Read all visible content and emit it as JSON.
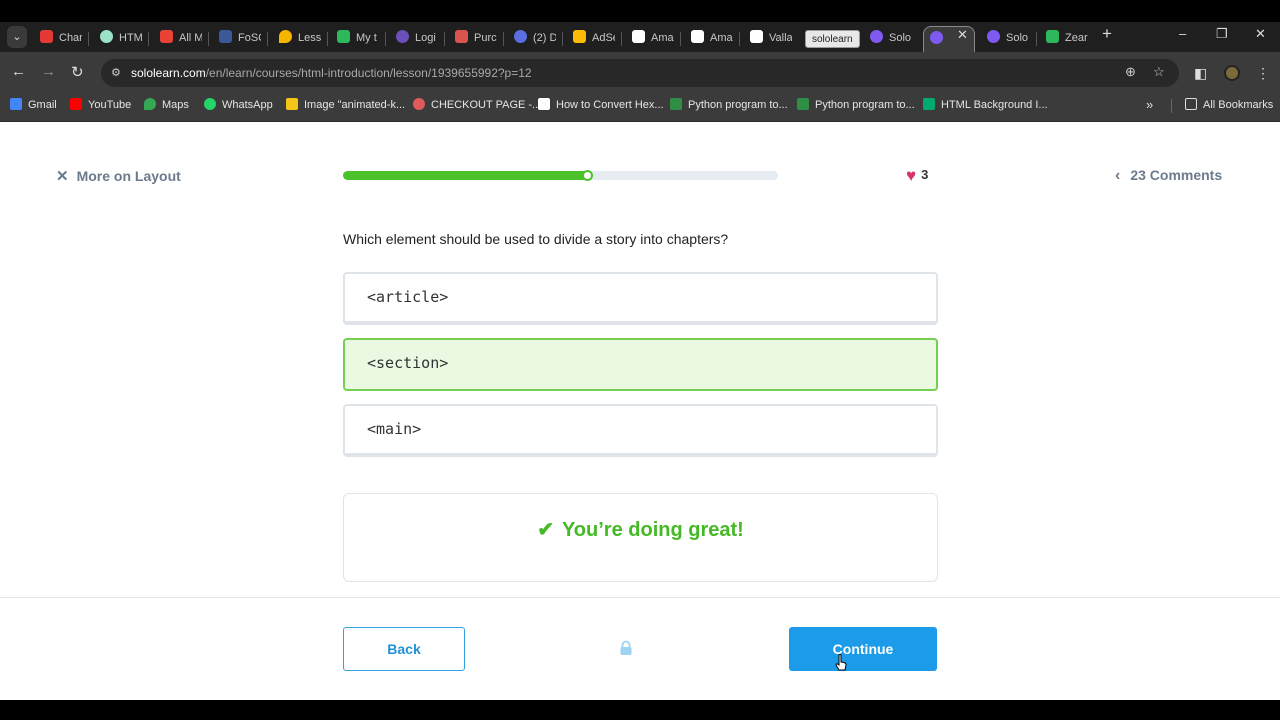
{
  "browser": {
    "tabs": [
      {
        "label": "Char",
        "color": "#e53935"
      },
      {
        "label": "HTM",
        "color": "#9be3c8"
      },
      {
        "label": "All M",
        "color": "#ea4335"
      },
      {
        "label": "FoSC",
        "color": "#3b5998"
      },
      {
        "label": "Less",
        "color": "#f7b500"
      },
      {
        "label": "My t",
        "color": "#2eb85c"
      },
      {
        "label": "Logi",
        "color": "#6b4fbb"
      },
      {
        "label": "Purc",
        "color": "#d9534f"
      },
      {
        "label": "(2) D",
        "color": "#5b6ee1"
      },
      {
        "label": "AdSe",
        "color": "#fbbc05"
      },
      {
        "label": "Ama",
        "color": "#ffffff"
      },
      {
        "label": "Ama",
        "color": "#ffffff"
      },
      {
        "label": "Valla",
        "color": "#ffffff"
      },
      {
        "label": "Solo",
        "color": "#7f5af0"
      },
      {
        "label": "",
        "color": "#7f5af0"
      },
      {
        "label": "Solo",
        "color": "#7f5af0"
      },
      {
        "label": "Zear",
        "color": "#2eb85c"
      }
    ],
    "tooltip": "sololearn",
    "url_host": "sololearn.com",
    "url_path": "/en/learn/courses/html-introduction/lesson/1939655992?p=12",
    "bookmarks": [
      {
        "label": "Gmail",
        "color": "#4285f4"
      },
      {
        "label": "YouTube",
        "color": "#ff0000"
      },
      {
        "label": "Maps",
        "color": "#34a853"
      },
      {
        "label": "WhatsApp",
        "color": "#25d366"
      },
      {
        "label": "Image \"animated-k...",
        "color": "#f5c518"
      },
      {
        "label": "CHECKOUT PAGE -...",
        "color": "#e05a5a"
      },
      {
        "label": "How to Convert Hex...",
        "color": "#ffffff"
      },
      {
        "label": "Python program to...",
        "color": "#2f8d46"
      },
      {
        "label": "Python program to...",
        "color": "#2f8d46"
      },
      {
        "label": "HTML Background I...",
        "color": "#04aa6d"
      }
    ],
    "all_bookmarks": "All Bookmarks"
  },
  "lesson": {
    "close_label": "More on Layout",
    "progress": 0.57,
    "hearts": "3",
    "comments_label": "23 Comments",
    "question": "Which element should be used to divide a story into chapters?",
    "options": [
      "<article>",
      "<section>",
      "<main>"
    ],
    "selected_option": 1,
    "feedback": "You’re doing great!",
    "back_label": "Back",
    "continue_label": "Continue"
  },
  "colors": {
    "accent_green": "#4cc22a",
    "accent_blue": "#1c9be8",
    "heart": "#d6336c"
  }
}
